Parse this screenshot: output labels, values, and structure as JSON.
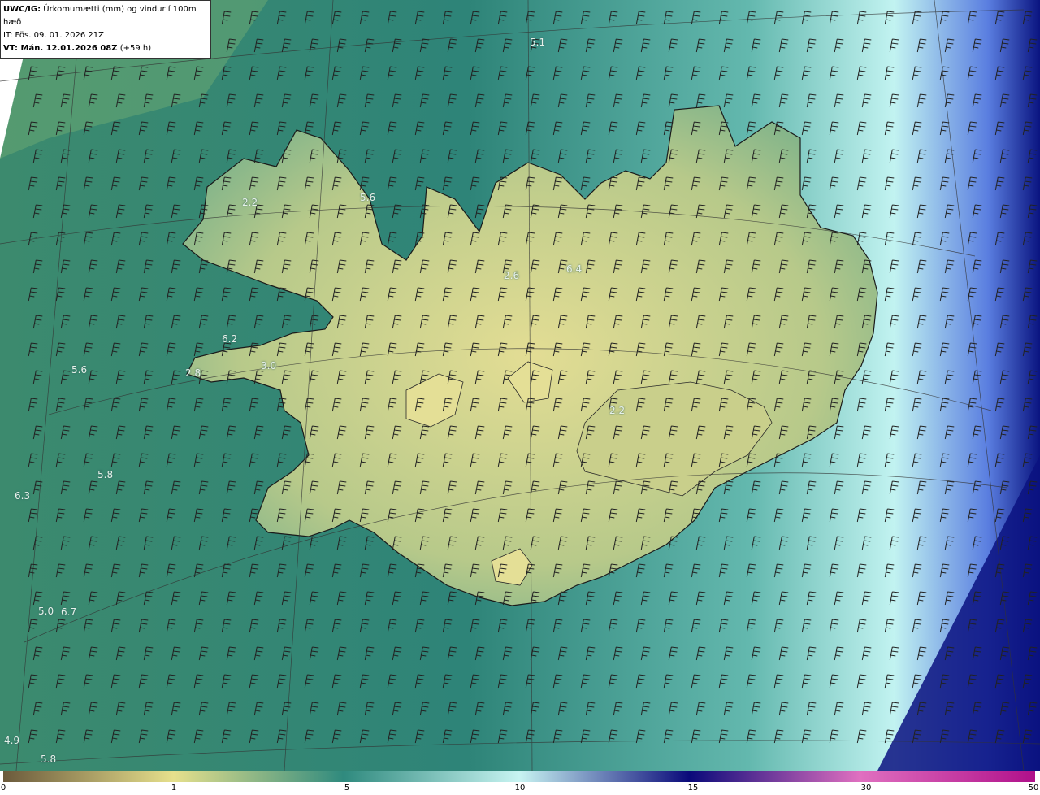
{
  "header": {
    "model_label": "UWC/IG:",
    "title": "Úrkomumætti (mm) og vindur í 100m hæð",
    "it_line": "IT: Fös. 09. 01. 2026 21Z",
    "vt_label": "VT: Mán. 12.01.2026 08Z",
    "vt_offset": "(+59 h)"
  },
  "map": {
    "land_color": "#d7d99a",
    "sea_color": "#2f8a7e",
    "sea_light_color": "#bff2ef",
    "deep_color": "#0a1a86",
    "values": [
      {
        "text": "5.1"
      },
      {
        "text": "5.6"
      },
      {
        "text": "2.2"
      },
      {
        "text": "6.4"
      },
      {
        "text": "2.6"
      },
      {
        "text": "6.2"
      },
      {
        "text": "3.0"
      },
      {
        "text": "5.6"
      },
      {
        "text": "2.8"
      },
      {
        "text": "5.8"
      },
      {
        "text": "6.3"
      },
      {
        "text": "5.0"
      },
      {
        "text": "6.7"
      },
      {
        "text": "4.9"
      },
      {
        "text": "5.8"
      },
      {
        "text": "2.2"
      }
    ]
  },
  "legend": {
    "ticks": [
      "0",
      "1",
      "5",
      "10",
      "15",
      "30",
      "50"
    ],
    "stops": [
      "#6b5a3c",
      "#e6e08c",
      "#2f8a7e",
      "#c8f4f2",
      "#0a0a7a",
      "#e070c0",
      "#b0108a"
    ]
  }
}
